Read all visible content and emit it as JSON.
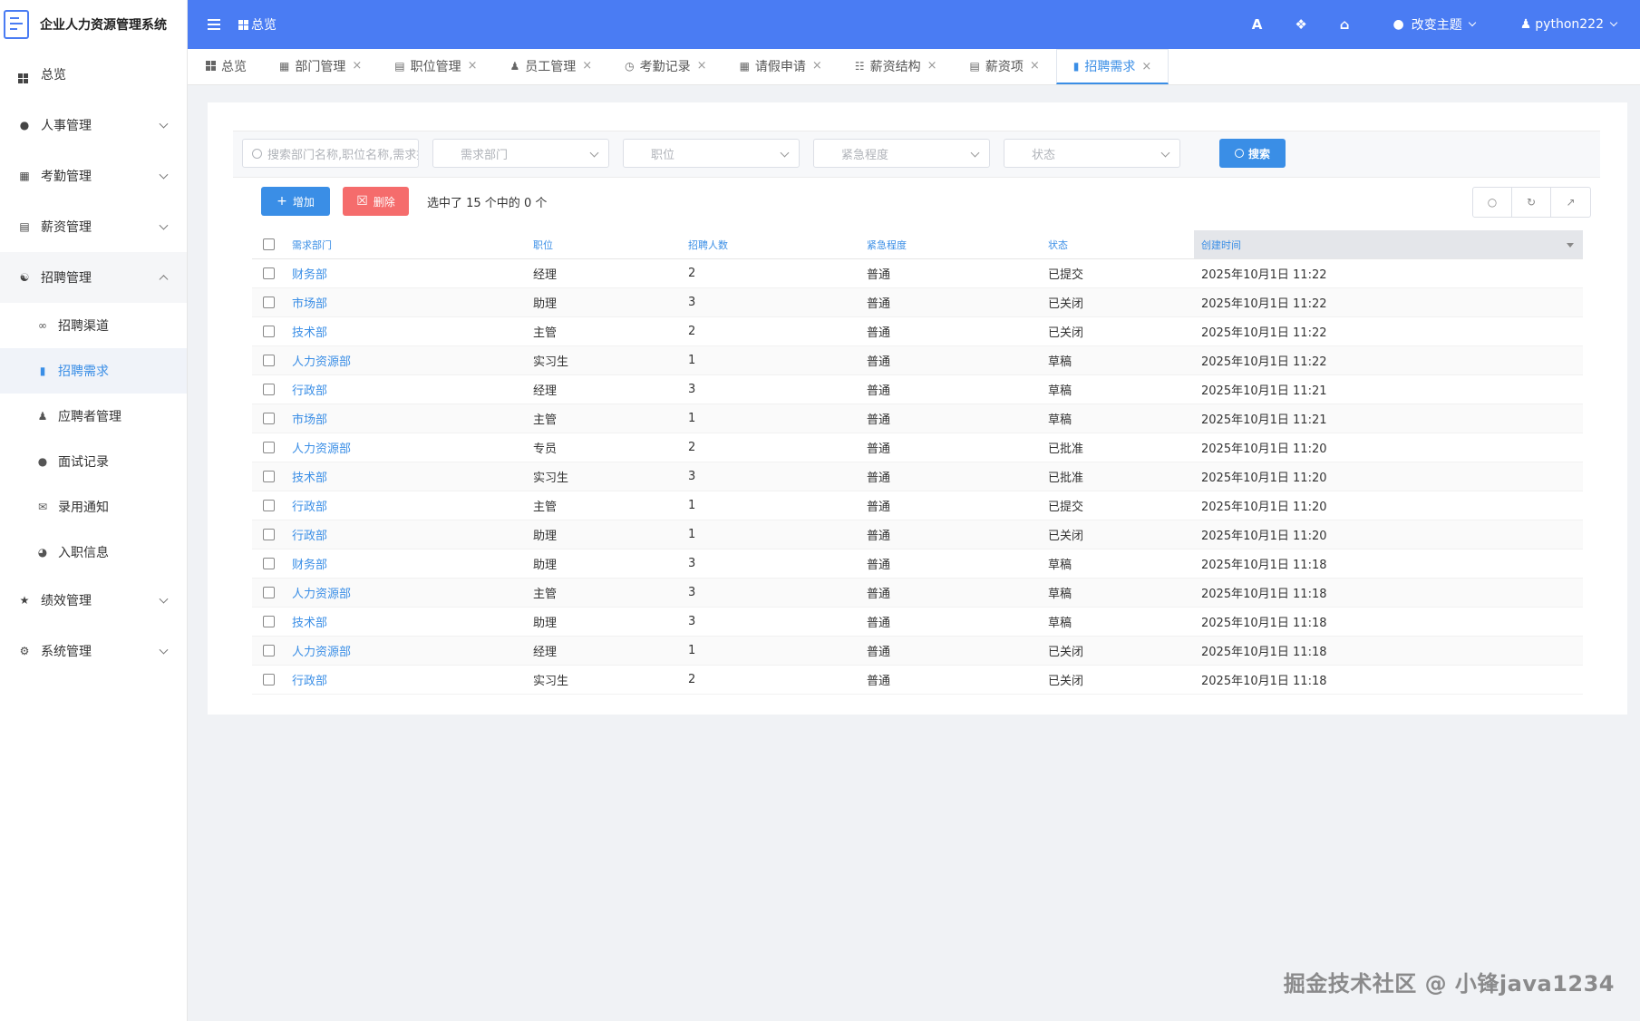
{
  "app": {
    "title": "企业人力资源管理系统",
    "accent": "#4a7cf3",
    "link_color": "#3a8ee6",
    "danger": "#f56c6c"
  },
  "sidebar": {
    "items": [
      {
        "label": "总览",
        "icon": "grid-icon"
      },
      {
        "label": "人事管理",
        "icon": "users-icon"
      },
      {
        "label": "考勤管理",
        "icon": "calendar-check-icon"
      },
      {
        "label": "薪资管理",
        "icon": "list-alt-icon"
      },
      {
        "label": "招聘管理",
        "icon": "handshake-icon"
      }
    ],
    "recruit_sub": [
      {
        "label": "招聘渠道",
        "icon": "link-icon"
      },
      {
        "label": "招聘需求",
        "icon": "file-icon"
      },
      {
        "label": "应聘者管理",
        "icon": "user-plus-icon"
      },
      {
        "label": "面试记录",
        "icon": "comments-icon"
      },
      {
        "label": "录用通知",
        "icon": "envelope-icon"
      },
      {
        "label": "入职信息",
        "icon": "pie-chart-icon"
      }
    ],
    "bottom_items": [
      {
        "label": "绩效管理",
        "icon": "trophy-icon"
      },
      {
        "label": "系统管理",
        "icon": "cogs-icon"
      }
    ]
  },
  "topbar": {
    "breadcrumb": "总览",
    "font_btn": "A",
    "theme_label": "改变主题",
    "user_name": "python222"
  },
  "tabs": [
    {
      "label": "总览",
      "icon": "grid-icon",
      "closable": false
    },
    {
      "label": "部门管理",
      "icon": "building-icon",
      "closable": true
    },
    {
      "label": "职位管理",
      "icon": "briefcase-icon",
      "closable": true
    },
    {
      "label": "员工管理",
      "icon": "user-icon",
      "closable": true
    },
    {
      "label": "考勤记录",
      "icon": "clock-icon",
      "closable": true
    },
    {
      "label": "请假申请",
      "icon": "calendar-icon",
      "closable": true
    },
    {
      "label": "薪资结构",
      "icon": "sitemap-icon",
      "closable": true
    },
    {
      "label": "薪资项",
      "icon": "list-alt-icon",
      "closable": true
    },
    {
      "label": "招聘需求",
      "icon": "file-icon",
      "closable": true,
      "active": true
    }
  ],
  "filters": {
    "search_placeholder": "搜索部门名称,职位名称,需求描述",
    "dept_placeholder": "需求部门",
    "pos_placeholder": "职位",
    "urgency_placeholder": "紧急程度",
    "status_placeholder": "状态",
    "search_btn": "搜索"
  },
  "toolbar": {
    "add_label": "增加",
    "delete_label": "删除",
    "selection_info": "选中了 15 个中的 0 个"
  },
  "table": {
    "headers": [
      "需求部门",
      "职位",
      "招聘人数",
      "紧急程度",
      "状态",
      "创建时间"
    ],
    "rows": [
      [
        "财务部",
        "经理",
        "2",
        "普通",
        "已提交",
        "2025年10月1日 11:22"
      ],
      [
        "市场部",
        "助理",
        "3",
        "普通",
        "已关闭",
        "2025年10月1日 11:22"
      ],
      [
        "技术部",
        "主管",
        "2",
        "普通",
        "已关闭",
        "2025年10月1日 11:22"
      ],
      [
        "人力资源部",
        "实习生",
        "1",
        "普通",
        "草稿",
        "2025年10月1日 11:22"
      ],
      [
        "行政部",
        "经理",
        "3",
        "普通",
        "草稿",
        "2025年10月1日 11:21"
      ],
      [
        "市场部",
        "主管",
        "1",
        "普通",
        "草稿",
        "2025年10月1日 11:21"
      ],
      [
        "人力资源部",
        "专员",
        "2",
        "普通",
        "已批准",
        "2025年10月1日 11:20"
      ],
      [
        "技术部",
        "实习生",
        "3",
        "普通",
        "已批准",
        "2025年10月1日 11:20"
      ],
      [
        "行政部",
        "主管",
        "1",
        "普通",
        "已提交",
        "2025年10月1日 11:20"
      ],
      [
        "行政部",
        "助理",
        "1",
        "普通",
        "已关闭",
        "2025年10月1日 11:20"
      ],
      [
        "财务部",
        "助理",
        "3",
        "普通",
        "草稿",
        "2025年10月1日 11:18"
      ],
      [
        "人力资源部",
        "主管",
        "3",
        "普通",
        "草稿",
        "2025年10月1日 11:18"
      ],
      [
        "技术部",
        "助理",
        "3",
        "普通",
        "草稿",
        "2025年10月1日 11:18"
      ],
      [
        "人力资源部",
        "经理",
        "1",
        "普通",
        "已关闭",
        "2025年10月1日 11:18"
      ],
      [
        "行政部",
        "实习生",
        "2",
        "普通",
        "已关闭",
        "2025年10月1日 11:18"
      ]
    ]
  },
  "watermark": "掘金技术社区 @ 小锋java1234"
}
